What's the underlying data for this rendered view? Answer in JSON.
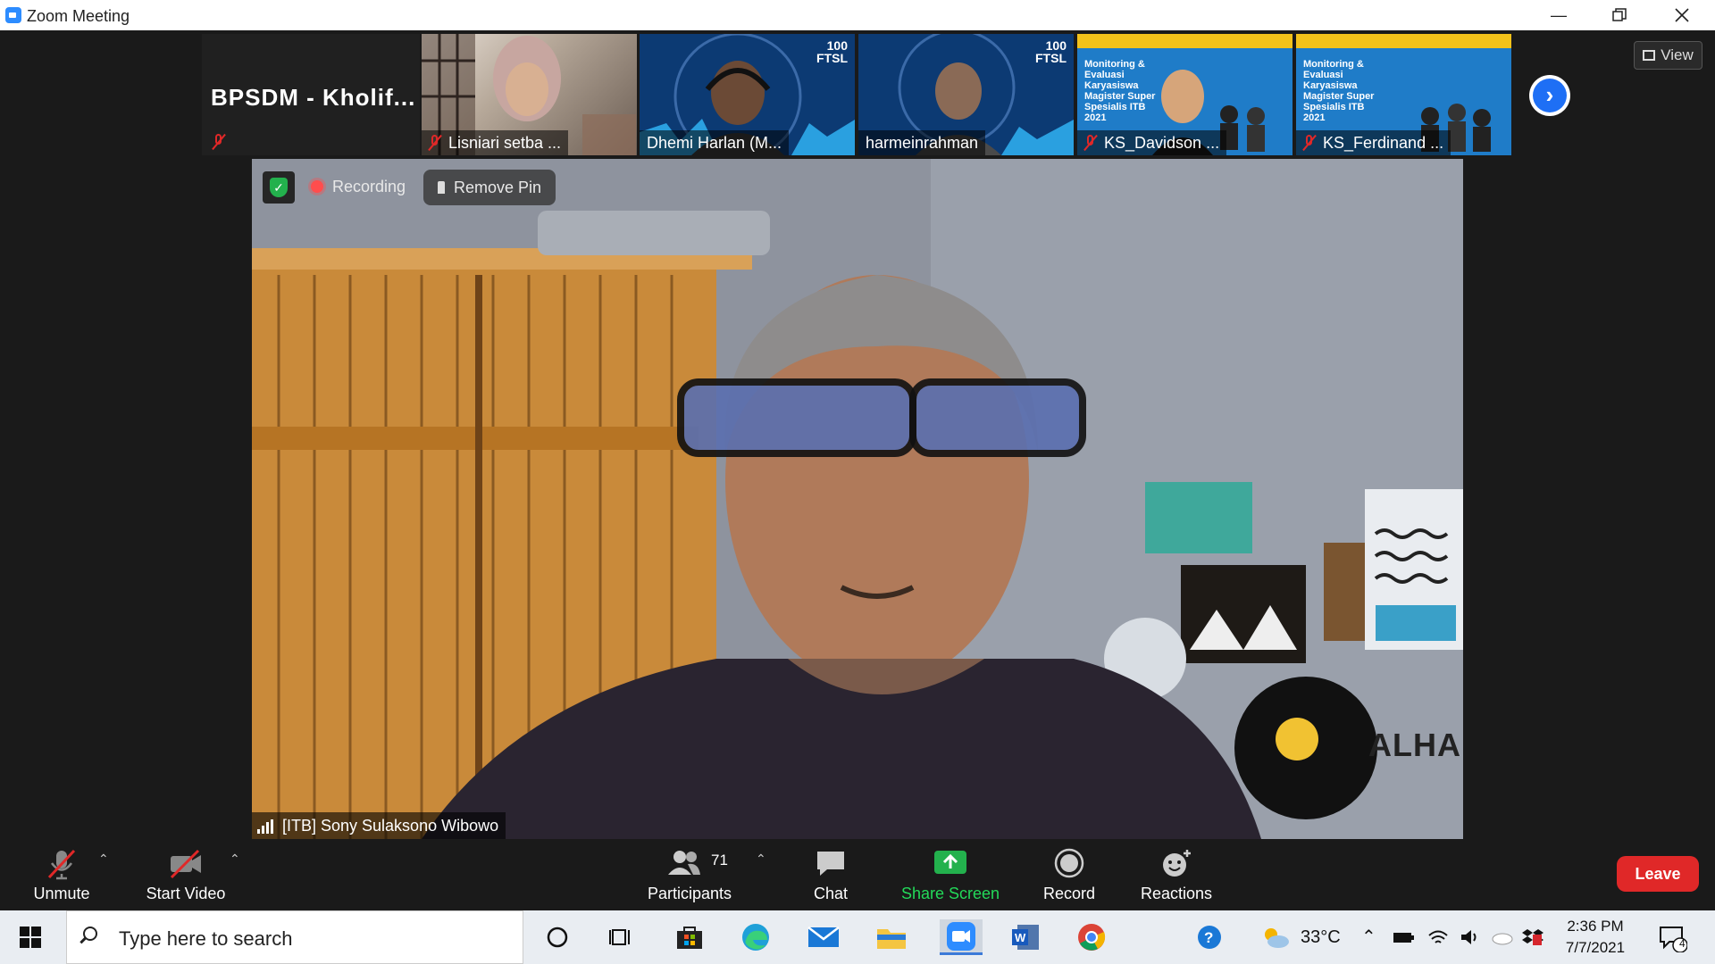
{
  "window": {
    "title": "Zoom Meeting"
  },
  "gallery": {
    "featured_name": "BPSDM - Kholif...",
    "tiles": [
      {
        "name": "Lisniari setba ..."
      },
      {
        "name": "Dhemi Harlan (M..."
      },
      {
        "name": "harmeinrahman"
      },
      {
        "name": "KS_Davidson ..."
      },
      {
        "name": "KS_Ferdinand ..."
      }
    ],
    "view_label": "View",
    "ftsl_badge": "100 FTSL",
    "poster_text": "Monitoring & Evaluasi Karyasiswa Magister Super Spesialis ITB 2021"
  },
  "main": {
    "recording_label": "Recording",
    "remove_pin_label": "Remove Pin",
    "speaker_name": "[ITB] Sony Sulaksono Wibowo",
    "wall_sign": "ALHAMD"
  },
  "toolbar": {
    "unmute_label": "Unmute",
    "start_video_label": "Start Video",
    "participants_label": "Participants",
    "participants_count": "71",
    "chat_label": "Chat",
    "share_screen_label": "Share Screen",
    "record_label": "Record",
    "reactions_label": "Reactions",
    "leave_label": "Leave"
  },
  "taskbar": {
    "search_placeholder": "Type here to search",
    "temperature": "33°C",
    "time": "2:36 PM",
    "date": "7/7/2021",
    "notification_count": "4"
  },
  "colors": {
    "accent_blue": "#2d8cff",
    "leave_red": "#e02828",
    "share_green": "#23d959",
    "recording_red": "#ff4d4d"
  }
}
